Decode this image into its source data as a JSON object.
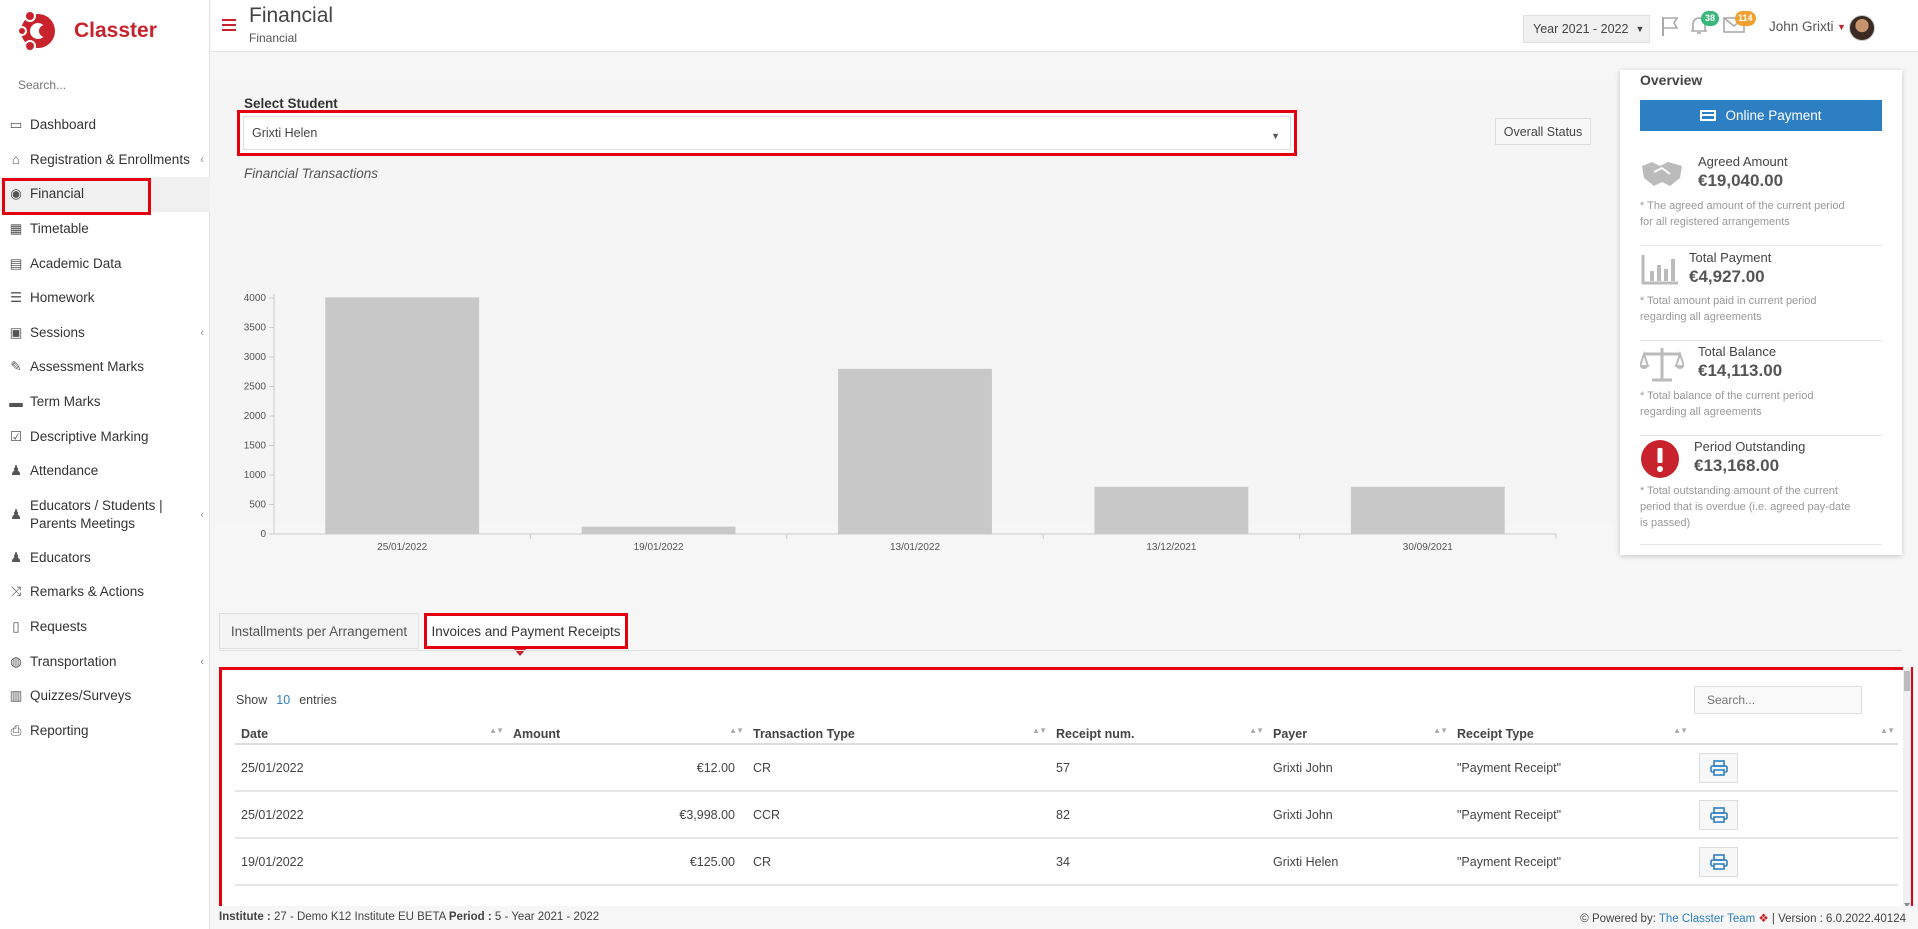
{
  "app": {
    "name": "Classter"
  },
  "sidebar": {
    "search_placeholder": "Search...",
    "items": [
      {
        "label": "Dashboard",
        "icon": "laptop-icon"
      },
      {
        "label": "Registration & Enrollments",
        "icon": "bank-icon",
        "has_children": true
      },
      {
        "label": "Financial",
        "icon": "coins-icon",
        "active": true
      },
      {
        "label": "Timetable",
        "icon": "calendar-icon"
      },
      {
        "label": "Academic Data",
        "icon": "id-card-icon"
      },
      {
        "label": "Homework",
        "icon": "list-icon"
      },
      {
        "label": "Sessions",
        "icon": "chalkboard-icon",
        "has_children": true
      },
      {
        "label": "Assessment Marks",
        "icon": "edit-icon"
      },
      {
        "label": "Term Marks",
        "icon": "book-icon"
      },
      {
        "label": "Descriptive Marking",
        "icon": "checkbox-icon"
      },
      {
        "label": "Attendance",
        "icon": "user-check-icon"
      },
      {
        "label": "Educators / Students | Parents Meetings",
        "icon": "users-icon",
        "has_children": true
      },
      {
        "label": "Educators",
        "icon": "users-icon"
      },
      {
        "label": "Remarks & Actions",
        "icon": "random-icon"
      },
      {
        "label": "Requests",
        "icon": "file-icon"
      },
      {
        "label": "Transportation",
        "icon": "bus-icon",
        "has_children": true
      },
      {
        "label": "Quizzes/Surveys",
        "icon": "clipboard-icon"
      },
      {
        "label": "Reporting",
        "icon": "print-icon"
      }
    ]
  },
  "header": {
    "title": "Financial",
    "subtitle": "Financial",
    "year": "Year 2021 - 2022",
    "notifications_count": "38",
    "messages_count": "114",
    "user_name": "John Grixti"
  },
  "student": {
    "label": "Select Student",
    "selected": "Grixti Helen",
    "overall_status_label": "Overall Status"
  },
  "chart_title": "Financial Transactions",
  "chart_data": {
    "type": "bar",
    "categories": [
      "25/01/2022",
      "19/01/2022",
      "13/01/2022",
      "13/12/2021",
      "30/09/2021"
    ],
    "values": [
      4010,
      125,
      2800,
      800,
      800
    ],
    "yticks": [
      0,
      500,
      1000,
      1500,
      2000,
      2500,
      3000,
      3500,
      4000
    ],
    "ylim": [
      0,
      4000
    ],
    "bar_color": "#c8c8c8"
  },
  "overview": {
    "title": "Overview",
    "online_payment_label": "Online Payment",
    "cards": [
      {
        "label": "Agreed Amount",
        "value": "€19,040.00",
        "note": "* The agreed amount of the current period for all registered arrangements",
        "icon": "handshake-icon"
      },
      {
        "label": "Total Payment",
        "value": "€4,927.00",
        "note": "* Total amount paid in current period regarding all agreements",
        "icon": "bar-chart-icon"
      },
      {
        "label": "Total Balance",
        "value": "€14,113.00",
        "note": "* Total balance of the current period regarding all agreements",
        "icon": "balance-scale-icon"
      },
      {
        "label": "Period Outstanding",
        "value": "€13,168.00",
        "note": "* Total outstanding amount of the current period that is overdue (i.e. agreed pay-date is passed)",
        "icon": "exclamation-icon"
      }
    ]
  },
  "tabs": {
    "installments": "Installments per Arrangement",
    "invoices": "Invoices and Payment Receipts"
  },
  "table": {
    "show_label": "Show",
    "entries_count": "10",
    "entries_label": "entries",
    "search_placeholder": "Search...",
    "columns": [
      "Date",
      "Amount",
      "Transaction Type",
      "Receipt num.",
      "Payer",
      "Receipt Type",
      ""
    ],
    "rows": [
      {
        "date": "25/01/2022",
        "amount": "€12.00",
        "type": "CR",
        "receipt": "57",
        "payer": "Grixti John",
        "receipt_type": "\"Payment Receipt\""
      },
      {
        "date": "25/01/2022",
        "amount": "€3,998.00",
        "type": "CCR",
        "receipt": "82",
        "payer": "Grixti John",
        "receipt_type": "\"Payment Receipt\""
      },
      {
        "date": "19/01/2022",
        "amount": "€125.00",
        "type": "CR",
        "receipt": "34",
        "payer": "Grixti Helen",
        "receipt_type": "\"Payment Receipt\""
      }
    ]
  },
  "footer": {
    "institute_label": "Institute :",
    "institute_value": "27 - Demo K12 Institute EU BETA",
    "period_label": "Period :",
    "period_value": "5 - Year 2021 - 2022",
    "powered_label": "Powered by:",
    "powered_link": "The Classter Team",
    "version": "| Version : 6.0.2022.40124"
  },
  "colors": {
    "brand": "#c8232c",
    "accent": "#2d7fc3",
    "highlight": "#e3000f"
  }
}
